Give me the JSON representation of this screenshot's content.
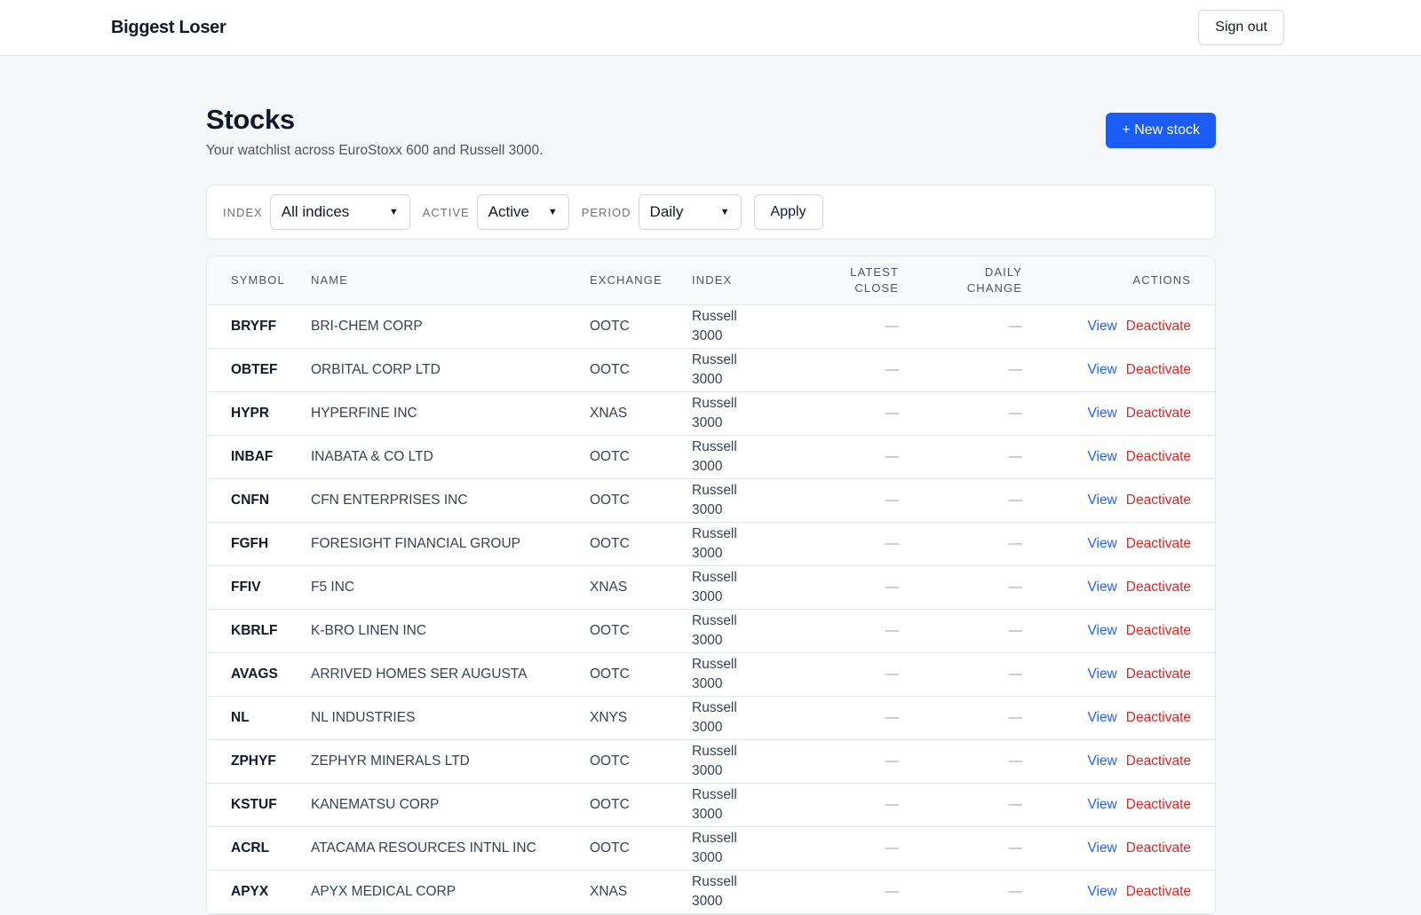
{
  "app": {
    "brand": "Biggest Loser",
    "sign_out_label": "Sign out"
  },
  "page": {
    "title": "Stocks",
    "subtitle": "Your watchlist across EuroStoxx 600 and Russell 3000.",
    "new_stock_label": "+ New stock"
  },
  "filters": {
    "index_label": "INDEX",
    "index_value": "All indices",
    "active_label": "ACTIVE",
    "active_value": "Active",
    "period_label": "PERIOD",
    "period_value": "Daily",
    "apply_label": "Apply"
  },
  "table": {
    "headers": {
      "symbol": "SYMBOL",
      "name": "NAME",
      "exchange": "EXCHANGE",
      "index": "INDEX",
      "latest_close_1": "LATEST",
      "latest_close_2": "CLOSE",
      "daily_change_1": "DAILY",
      "daily_change_2": "CHANGE",
      "actions": "ACTIONS"
    },
    "view_label": "View",
    "deactivate_label": "Deactivate",
    "rows": [
      {
        "symbol": "BRYFF",
        "name": "BRI-CHEM CORP",
        "exchange": "OOTC",
        "index_1": "Russell",
        "index_2": "3000",
        "latest_close": "—",
        "daily_change": "—"
      },
      {
        "symbol": "OBTEF",
        "name": "ORBITAL CORP LTD",
        "exchange": "OOTC",
        "index_1": "Russell",
        "index_2": "3000",
        "latest_close": "—",
        "daily_change": "—"
      },
      {
        "symbol": "HYPR",
        "name": "HYPERFINE INC",
        "exchange": "XNAS",
        "index_1": "Russell",
        "index_2": "3000",
        "latest_close": "—",
        "daily_change": "—"
      },
      {
        "symbol": "INBAF",
        "name": "INABATA & CO LTD",
        "exchange": "OOTC",
        "index_1": "Russell",
        "index_2": "3000",
        "latest_close": "—",
        "daily_change": "—"
      },
      {
        "symbol": "CNFN",
        "name": "CFN ENTERPRISES INC",
        "exchange": "OOTC",
        "index_1": "Russell",
        "index_2": "3000",
        "latest_close": "—",
        "daily_change": "—"
      },
      {
        "symbol": "FGFH",
        "name": "FORESIGHT FINANCIAL GROUP",
        "exchange": "OOTC",
        "index_1": "Russell",
        "index_2": "3000",
        "latest_close": "—",
        "daily_change": "—"
      },
      {
        "symbol": "FFIV",
        "name": "F5 INC",
        "exchange": "XNAS",
        "index_1": "Russell",
        "index_2": "3000",
        "latest_close": "—",
        "daily_change": "—"
      },
      {
        "symbol": "KBRLF",
        "name": "K-BRO LINEN INC",
        "exchange": "OOTC",
        "index_1": "Russell",
        "index_2": "3000",
        "latest_close": "—",
        "daily_change": "—"
      },
      {
        "symbol": "AVAGS",
        "name": "ARRIVED HOMES SER AUGUSTA",
        "exchange": "OOTC",
        "index_1": "Russell",
        "index_2": "3000",
        "latest_close": "—",
        "daily_change": "—"
      },
      {
        "symbol": "NL",
        "name": "NL INDUSTRIES",
        "exchange": "XNYS",
        "index_1": "Russell",
        "index_2": "3000",
        "latest_close": "—",
        "daily_change": "—"
      },
      {
        "symbol": "ZPHYF",
        "name": "ZEPHYR MINERALS LTD",
        "exchange": "OOTC",
        "index_1": "Russell",
        "index_2": "3000",
        "latest_close": "—",
        "daily_change": "—"
      },
      {
        "symbol": "KSTUF",
        "name": "KANEMATSU CORP",
        "exchange": "OOTC",
        "index_1": "Russell",
        "index_2": "3000",
        "latest_close": "—",
        "daily_change": "—"
      },
      {
        "symbol": "ACRL",
        "name": "ATACAMA RESOURCES INTNL INC",
        "exchange": "OOTC",
        "index_1": "Russell",
        "index_2": "3000",
        "latest_close": "—",
        "daily_change": "—"
      },
      {
        "symbol": "APYX",
        "name": "APYX MEDICAL CORP",
        "exchange": "XNAS",
        "index_1": "Russell",
        "index_2": "3000",
        "latest_close": "—",
        "daily_change": "—"
      }
    ]
  },
  "colors": {
    "primary": "#1a5cf5",
    "link": "#2563eb",
    "danger": "#dc2626"
  }
}
